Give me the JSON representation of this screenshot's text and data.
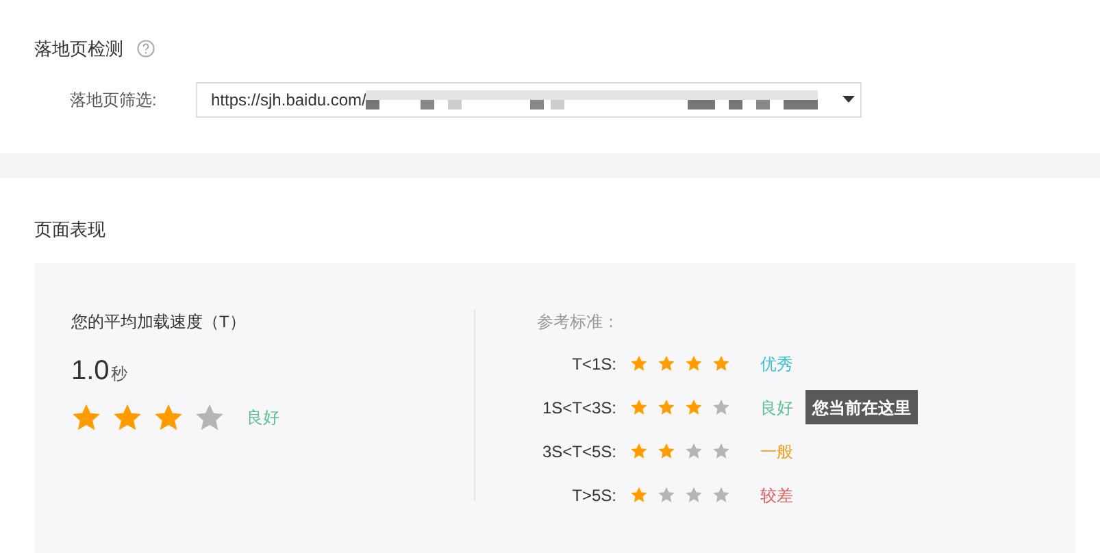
{
  "landing_check": {
    "title": "落地页检测",
    "filter": {
      "label": "落地页筛选:",
      "value": "https://sjh.baidu.com/"
    }
  },
  "performance": {
    "title": "页面表现",
    "current": {
      "label": "您的平均加载速度（T）",
      "value": "1.0",
      "unit": "秒",
      "stars": 3,
      "rating": "良好",
      "color": "#5bbf8f"
    },
    "reference": {
      "title": "参考标准：",
      "rows": [
        {
          "range": "T<1S:",
          "stars": 4,
          "rating": "优秀",
          "color": "#3cc0d8"
        },
        {
          "range": "1S<T<3S:",
          "stars": 3,
          "rating": "良好",
          "color": "#5bbf8f",
          "tooltip": "您当前在这里"
        },
        {
          "range": "3S<T<5S:",
          "stars": 2,
          "rating": "一般",
          "color": "#f0a020"
        },
        {
          "range": "T>5S:",
          "stars": 1,
          "rating": "较差",
          "color": "#e06060"
        }
      ]
    }
  }
}
